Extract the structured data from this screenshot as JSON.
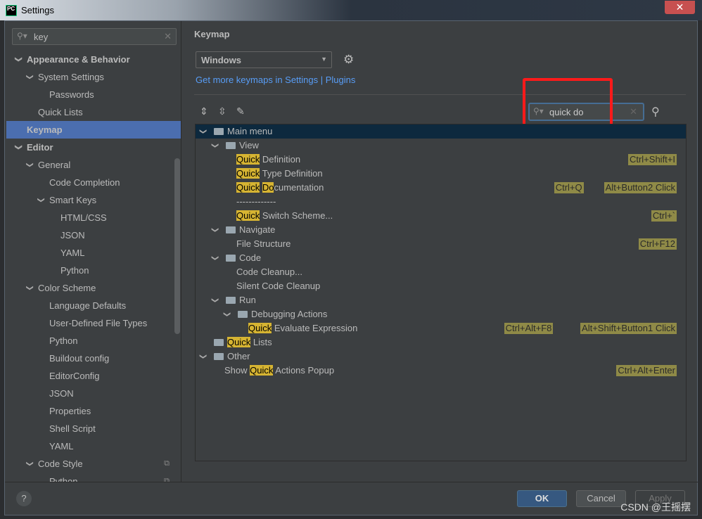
{
  "window": {
    "title": "Settings",
    "close": "✕",
    "logo": "PC"
  },
  "sidebar": {
    "search_value": "key",
    "items": [
      {
        "label": "Appearance & Behavior",
        "level": 0,
        "arrow": true,
        "bold": true
      },
      {
        "label": "System Settings",
        "level": 1,
        "arrow": true
      },
      {
        "label": "Passwords",
        "level": 2
      },
      {
        "label": "Quick Lists",
        "level": 1
      },
      {
        "label": "Keymap",
        "level": 0,
        "bold": true,
        "selected": true
      },
      {
        "label": "Editor",
        "level": 0,
        "arrow": true,
        "bold": true
      },
      {
        "label": "General",
        "level": 1,
        "arrow": true
      },
      {
        "label": "Code Completion",
        "level": 2
      },
      {
        "label": "Smart Keys",
        "level": 2,
        "arrow": true
      },
      {
        "label": "HTML/CSS",
        "level": 3
      },
      {
        "label": "JSON",
        "level": 3
      },
      {
        "label": "YAML",
        "level": 3
      },
      {
        "label": "Python",
        "level": 3
      },
      {
        "label": "Color Scheme",
        "level": 1,
        "arrow": true
      },
      {
        "label": "Language Defaults",
        "level": 2
      },
      {
        "label": "User-Defined File Types",
        "level": 2
      },
      {
        "label": "Python",
        "level": 2
      },
      {
        "label": "Buildout config",
        "level": 2
      },
      {
        "label": "EditorConfig",
        "level": 2
      },
      {
        "label": "JSON",
        "level": 2
      },
      {
        "label": "Properties",
        "level": 2
      },
      {
        "label": "Shell Script",
        "level": 2
      },
      {
        "label": "YAML",
        "level": 2
      },
      {
        "label": "Code Style",
        "level": 1,
        "arrow": true,
        "copy": true
      },
      {
        "label": "Python",
        "level": 2,
        "copy": true
      }
    ]
  },
  "main": {
    "title": "Keymap",
    "keymap_selected": "Windows",
    "link": "Get more keymaps in Settings | Plugins",
    "search_value": "quick do",
    "tree": [
      {
        "level": 0,
        "arrow": true,
        "folder": true,
        "parts": [
          {
            "t": "Main menu"
          }
        ],
        "selected": true
      },
      {
        "level": 1,
        "arrow": true,
        "folder": true,
        "parts": [
          {
            "t": "View"
          }
        ]
      },
      {
        "level": 2,
        "parts": [
          {
            "t": "Quick",
            "h": true
          },
          {
            "t": " Definition"
          }
        ],
        "shortcuts": [
          "Ctrl+Shift+I"
        ]
      },
      {
        "level": 2,
        "parts": [
          {
            "t": "Quick",
            "h": true
          },
          {
            "t": " Type Definition"
          }
        ]
      },
      {
        "level": 2,
        "parts": [
          {
            "t": "Quick",
            "h": true
          },
          {
            "t": " "
          },
          {
            "t": "Do",
            "h": true
          },
          {
            "t": "cumentation"
          }
        ],
        "shortcuts": [
          "Ctrl+Q",
          "Alt+Button2 Click"
        ]
      },
      {
        "level": 2,
        "parts": [
          {
            "t": "-------------"
          }
        ]
      },
      {
        "level": 2,
        "parts": [
          {
            "t": "Quick",
            "h": true
          },
          {
            "t": " Switch Scheme..."
          }
        ],
        "shortcuts": [
          "Ctrl+`"
        ]
      },
      {
        "level": 1,
        "arrow": true,
        "folder": true,
        "parts": [
          {
            "t": "Navigate"
          }
        ]
      },
      {
        "level": 2,
        "parts": [
          {
            "t": "File Structure"
          }
        ],
        "shortcuts": [
          "Ctrl+F12"
        ]
      },
      {
        "level": 1,
        "arrow": true,
        "folder": true,
        "parts": [
          {
            "t": "Code"
          }
        ]
      },
      {
        "level": 2,
        "parts": [
          {
            "t": "Code Cleanup..."
          }
        ]
      },
      {
        "level": 2,
        "parts": [
          {
            "t": "Silent Code Cleanup"
          }
        ]
      },
      {
        "level": 1,
        "arrow": true,
        "folder": true,
        "parts": [
          {
            "t": "Run"
          }
        ]
      },
      {
        "level": 2,
        "arrow": true,
        "folder": true,
        "parts": [
          {
            "t": "Debugging Actions"
          }
        ]
      },
      {
        "level": 3,
        "parts": [
          {
            "t": "Quick",
            "h": true
          },
          {
            "t": " Evaluate Expression"
          }
        ],
        "shortcuts": [
          "Ctrl+Alt+F8",
          "Alt+Shift+Button1 Click"
        ]
      },
      {
        "level": 0,
        "folder": true,
        "noarrowspace": true,
        "parts": [
          {
            "t": "Quick",
            "h": true
          },
          {
            "t": " Lists"
          }
        ]
      },
      {
        "level": 0,
        "arrow": true,
        "folder": true,
        "parts": [
          {
            "t": "Other"
          }
        ]
      },
      {
        "level": 1,
        "parts": [
          {
            "t": "Show "
          },
          {
            "t": "Quick",
            "h": true
          },
          {
            "t": " Actions Popup"
          }
        ],
        "shortcuts": [
          "Ctrl+Alt+Enter"
        ]
      }
    ]
  },
  "footer": {
    "help": "?",
    "ok": "OK",
    "cancel": "Cancel",
    "apply": "Apply",
    "watermark": "CSDN @王摇摆"
  },
  "colors": {
    "selection": "#4b6eaf",
    "highlight": "#d6b432",
    "shortcut": "#8f8a47",
    "annotation": "#ff1a1a"
  }
}
